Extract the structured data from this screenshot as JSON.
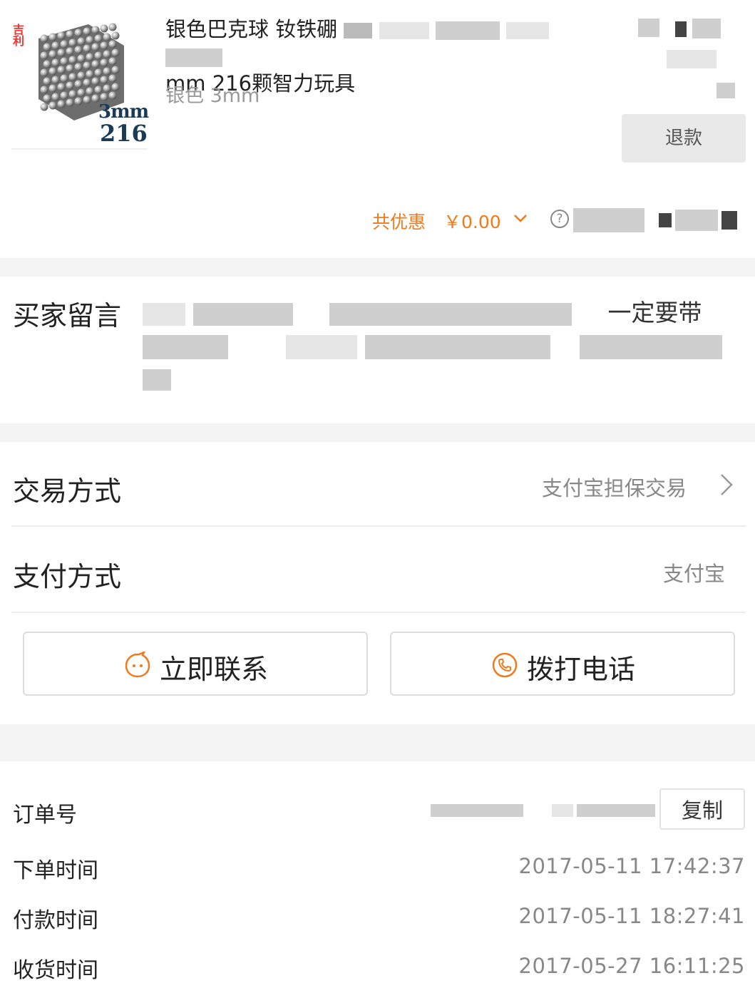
{
  "product": {
    "thumb_text_size": "3mm",
    "thumb_text_count": "216",
    "thumb_logo": "吉利",
    "title_line1": "银色巴克球 钕铁硼",
    "title_line2": "mm 216颗智力玩具",
    "sku": "银色 3mm",
    "refund_label": "退款"
  },
  "discount": {
    "label": "共优惠",
    "value": "￥0.00"
  },
  "message": {
    "label": "买家留言",
    "text_visible": "一定要带"
  },
  "trade": {
    "label": "交易方式",
    "value": "支付宝担保交易"
  },
  "payment": {
    "label": "支付方式",
    "value": "支付宝"
  },
  "actions": {
    "contact": "立即联系",
    "call": "拨打电话"
  },
  "order": {
    "number_label": "订单号",
    "copy_label": "复制",
    "created_label": "下单时间",
    "created_value": "2017-05-11 17:42:37",
    "paid_label": "付款时间",
    "paid_value": "2017-05-11 18:27:41",
    "received_label": "收货时间",
    "received_value": "2017-05-27 16:11:25"
  },
  "colors": {
    "accent": "#f07a1c",
    "background_gap": "#f4f4f4",
    "muted_text": "#888888"
  },
  "icons": [
    "help-icon",
    "chevron-down-icon",
    "chevron-right-icon",
    "chat-icon",
    "phone-icon"
  ]
}
